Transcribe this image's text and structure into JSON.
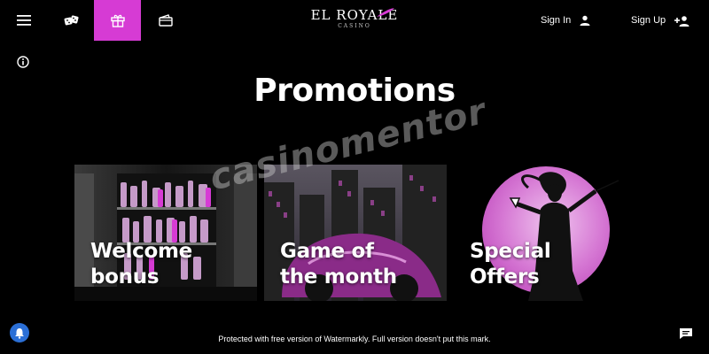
{
  "header": {
    "menu_icon": "hamburger-icon",
    "games_icon": "dice-icon",
    "promotions_icon": "gift-icon",
    "cashier_icon": "wallet-icon",
    "logo": {
      "main": "EL ROYALE",
      "sub": "CASINO"
    },
    "sign_in_label": "Sign In",
    "sign_in_icon": "user-icon",
    "sign_up_label": "Sign Up",
    "sign_up_icon": "user-plus-icon",
    "active_color": "#d63bd4"
  },
  "info_icon": "info-icon",
  "page_title": "Promotions",
  "cards": [
    {
      "label_line1": "Welcome",
      "label_line2": "bonus"
    },
    {
      "label_line1": "Game of",
      "label_line2": "the month"
    },
    {
      "label_line1": "Special",
      "label_line2": "Offers"
    }
  ],
  "watermark": "casinomentor",
  "footer_note": "Protected with free version of Watermarkly. Full version doesn't put this mark.",
  "bell_icon": "bell-icon",
  "chat_icon": "chat-icon",
  "accent_color": "#d63bd4"
}
